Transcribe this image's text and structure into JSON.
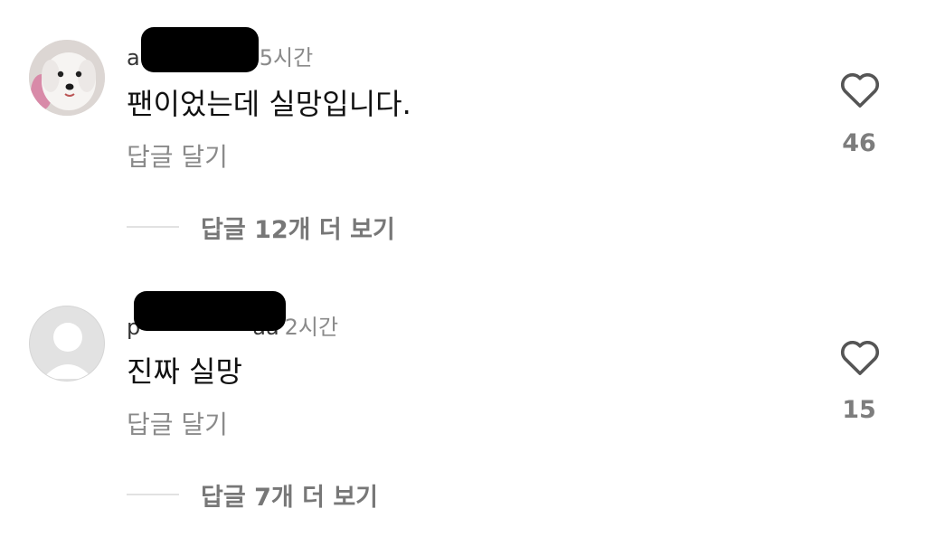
{
  "comments": [
    {
      "username": "a",
      "time": "5시간",
      "text": "팬이었는데 실망입니다.",
      "reply_label": "답글 달기",
      "more_replies": "답글 12개 더 보기",
      "likes": "46"
    },
    {
      "username": "p",
      "username_tail": "aa",
      "time": "2시간",
      "text": "진짜 실망",
      "reply_label": "답글 달기",
      "more_replies": "답글 7개 더 보기",
      "likes": "15"
    }
  ],
  "icons": {
    "like": "heart-outline-icon",
    "avatar_default": "person-silhouette-icon"
  },
  "colors": {
    "text": "#111111",
    "muted": "#8a8a8a",
    "redaction": "#000000"
  }
}
